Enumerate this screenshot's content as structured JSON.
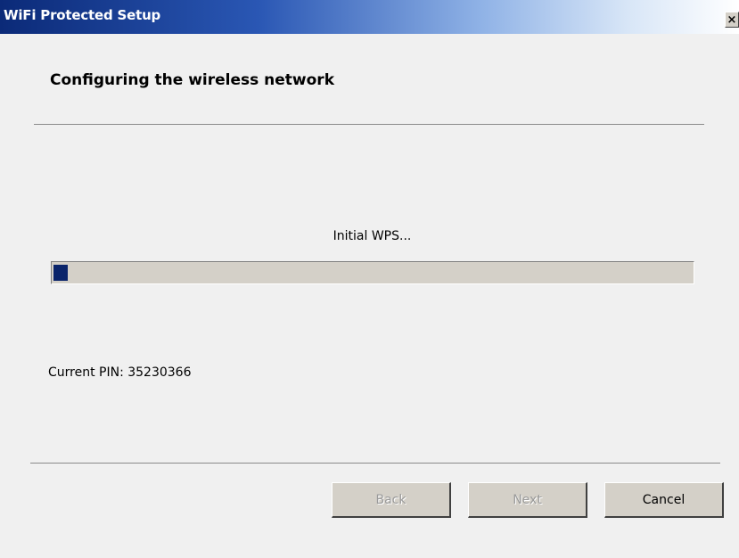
{
  "window": {
    "title": "WiFi Protected Setup",
    "close_glyph": "×"
  },
  "page": {
    "heading": "Configuring the wireless network",
    "status_text": "Initial WPS...",
    "progress_fraction": 0.025,
    "pin_text": "Current PIN: 35230366"
  },
  "buttons": {
    "back_label": "Back",
    "next_label": "Next",
    "cancel_label": "Cancel"
  },
  "colors": {
    "titlebar_start": "#0b2a78",
    "progress_fill": "#0a246a",
    "button_face": "#d4d0c8"
  },
  "icons": {
    "close": "close-icon"
  }
}
